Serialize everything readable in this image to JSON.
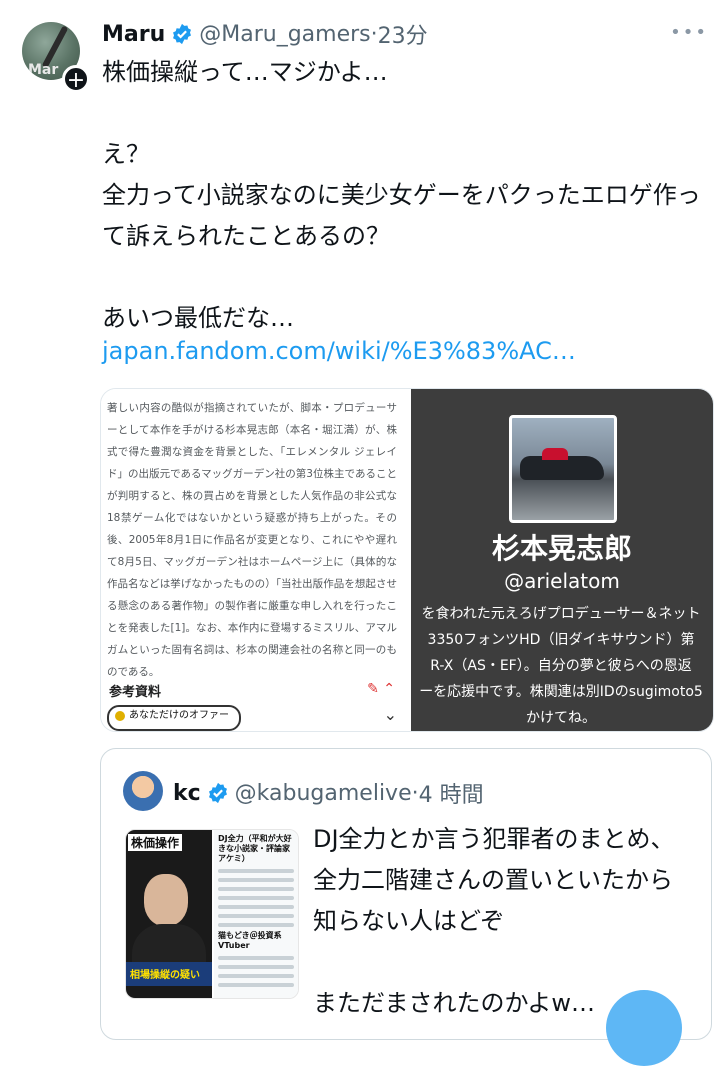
{
  "tweet": {
    "name": "Maru",
    "handle": "@Maru_gamers",
    "separator": "·",
    "time": "23分",
    "avatar_text": "Mar",
    "body": "株価操縦って…マジかよ…\n\nえ？\n全力って小説家なのに美少女ゲーをパクったエロゲ作って訴えられたことあるの？\n\nあいつ最低だな…",
    "link": "japan.fandom.com/wiki/%E3%83%AC…",
    "icons": {
      "follow": "plus-icon",
      "verified": "verified-badge-icon",
      "more": "more-options-icon"
    }
  },
  "media": {
    "wiki_text": "著しい内容の酷似が指摘されていたが、脚本・プロデューサーとして本作を手がける杉本晃志郎（本名・堀江満）が、株式で得た豊潤な資金を背景とした、「エレメンタル ジェレイド」の出版元であるマッグガーデン社の第3位株主であることが判明すると、株の買占めを背景とした人気作品の非公式な18禁ゲーム化ではないかという疑惑が持ち上がった。その後、2005年8月1日に作品名が変更となり、これにやや遅れて8月5日、マッグガーデン社はホームページ上に（具体的な作品名などは挙げなかったものの）「当社出版作品を想起させる懸念のある著作物」の製作者に厳重な申し入れを行ったことを発表した[1]。なお、本作内に登場するミスリル、アマルガムといった固有名詞は、杉本の関連会社の名称と同一のものである。",
    "wiki_ref": "参考資料",
    "offer_label": "あなただけのオファー",
    "profile_name": "杉本晃志郎",
    "profile_handle": "@arielatom",
    "profile_bio": "を食われた元えろげプロデューサー＆ネット\n3350フォンツHD（旧ダイキサウンド）第\nR-X（AS・EF）。自分の夢と彼らへの恩返\nーを応援中です。株関連は別IDのsugimoto5\nかけてね。"
  },
  "quote": {
    "name": "kc",
    "handle": "@kabugamelive",
    "separator": "·",
    "time": "4 時間",
    "thumb_caption": "株価操作",
    "thumb_bar": "相場操縦の疑い",
    "thumb_title": "DJ全力（平和が大好きな小説家・評論家アケミ）",
    "thumb_subtitle": "猫もどき＠投資系VTuber",
    "body": "DJ全力とか言う犯罪者のまとめ、全力二階建さんの置いといたから知らない人はどぞ\n\nまただまされたのかよw…"
  },
  "colors": {
    "link": "#1d9bf0",
    "verified": "#1d9bf0",
    "muted": "#536471"
  }
}
